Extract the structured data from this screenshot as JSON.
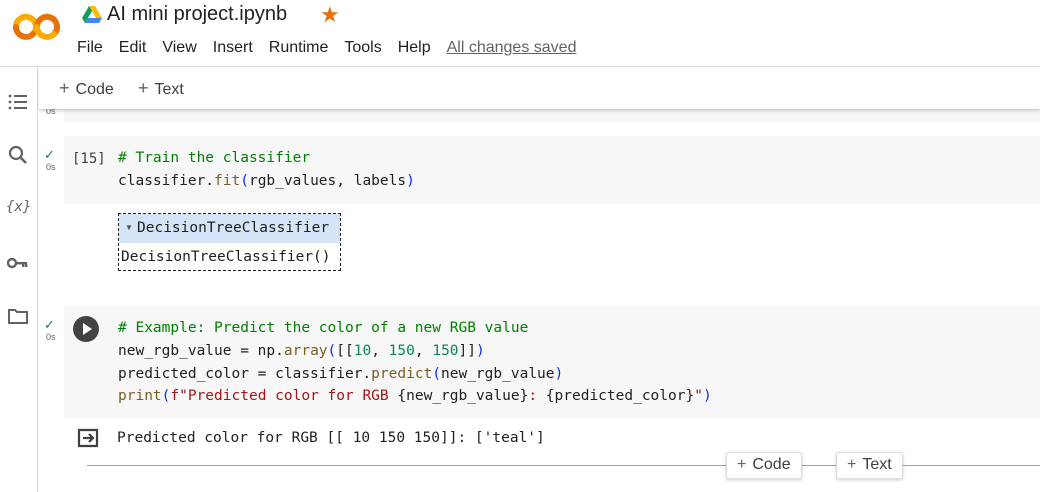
{
  "header": {
    "logo_text": "CO",
    "notebook_title": "AI mini project.ipynb",
    "menu": [
      "File",
      "Edit",
      "View",
      "Insert",
      "Runtime",
      "Tools",
      "Help"
    ],
    "save_status": "All changes saved"
  },
  "toolbar": {
    "add_code_label": "Code",
    "add_text_label": "Text"
  },
  "sidebar": {
    "items": [
      "table-of-contents",
      "search",
      "variables",
      "secrets",
      "files"
    ],
    "variables_label": "{x}"
  },
  "cells": [
    {
      "status_time": "0s",
      "exec_count": "[15]",
      "code": [
        "# Train the classifier",
        "classifier.fit(rgb_values, labels)"
      ],
      "output": {
        "estimator_title": "DecisionTreeClassifier",
        "estimator_repr": "DecisionTreeClassifier()"
      }
    },
    {
      "status_time": "0s",
      "code": [
        "# Example: Predict the color of a new RGB value",
        "new_rgb_value = np.array([[10, 150, 150]])",
        "predicted_color = classifier.predict(new_rgb_value)",
        "print(f\"Predicted color for RGB {new_rgb_value}: {predicted_color}\")"
      ],
      "output_text": "Predicted color for RGB [[ 10 150 150]]: ['teal']"
    }
  ],
  "prev_cell_time": "0s",
  "add_cell": {
    "code_label": "Code",
    "text_label": "Text"
  },
  "colors": {
    "accent": "#f9ab00",
    "logo_orange": "#e8710a",
    "comment_green": "#008000",
    "check_green": "#188038"
  }
}
